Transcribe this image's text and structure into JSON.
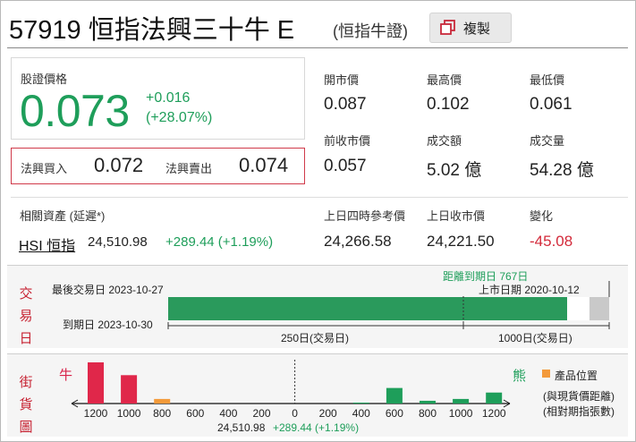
{
  "header": {
    "code": "57919",
    "name": "恒指法興三十牛 E",
    "type_tag": "(恒指牛證)",
    "copy_label": "複製"
  },
  "price": {
    "label": "股證價格",
    "value": "0.073",
    "change": "+0.016",
    "change_pct": "(+28.07%)"
  },
  "bidask": {
    "bid_label": "法興買入",
    "bid": "0.072",
    "ask_label": "法興賣出",
    "ask": "0.074"
  },
  "stats": {
    "open_label": "開市價",
    "open": "0.087",
    "high_label": "最高價",
    "high": "0.102",
    "low_label": "最低價",
    "low": "0.061",
    "prev_close_label": "前收市價",
    "prev_close": "0.057",
    "turnover_label": "成交額",
    "turnover": "5.02 億",
    "volume_label": "成交量",
    "volume": "54.28 億"
  },
  "underlying": {
    "label": "相關資產 (延遲*)",
    "name": "HSI 恒指",
    "price": "24,510.98",
    "change": "+289.44 (+1.19%)",
    "ref_4pm_label": "上日四時參考價",
    "ref_4pm": "24,266.58",
    "prev_close_label": "上日收市價",
    "prev_close": "24,221.50",
    "change_label": "變化",
    "change_val": "-45.08"
  },
  "trading": {
    "title_chars": [
      "交",
      "易",
      "日"
    ],
    "last_trade_label": "最後交易日 2023-10-27",
    "expiry_label": "到期日 2023-10-30",
    "days_to_expiry": "距離到期日 767日",
    "listing_label": "上市日期 2020-10-12",
    "elapsed_fraction": 0.946,
    "left_span_label": "250日(交易日)",
    "right_span_label": "1000日(交易日)"
  },
  "street": {
    "title_chars": [
      "街",
      "貨",
      "圖"
    ],
    "bull_label": "牛",
    "bear_label": "熊",
    "legend_label": "產品位置",
    "note_line1": "(與現貨價距離)",
    "note_line2": "(相對期指張數)",
    "underlying_ref": "24,510.98",
    "underlying_chg": "+289.44 (+1.19%)",
    "colors": {
      "bull": "#e0274a",
      "bear": "#1e9e5a",
      "product": "#f39a3a"
    }
  },
  "chart_data": {
    "type": "bar",
    "categories": [
      "1200",
      "1000",
      "800",
      "600",
      "400",
      "200",
      "0",
      "200",
      "400",
      "600",
      "800",
      "1000",
      "1200"
    ],
    "series": [
      {
        "name": "牛",
        "values": [
          45,
          31,
          5,
          0,
          0,
          0,
          0,
          0,
          0,
          0,
          0,
          0,
          0
        ]
      },
      {
        "name": "熊",
        "values": [
          0,
          0,
          0,
          0,
          0,
          0,
          0,
          0,
          1,
          17,
          3,
          5,
          12
        ]
      }
    ],
    "product_index": 2
  }
}
